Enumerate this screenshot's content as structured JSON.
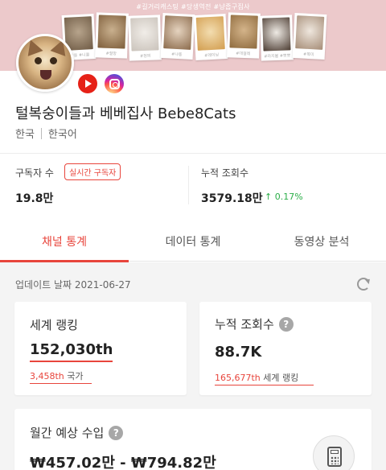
{
  "banner": {
    "tags": "#길거리캐스팅   #당생역전   #냥줍구집사",
    "photos": [
      {
        "caption": "야옹 #니콜",
        "color_a": "#b7a48c",
        "color_b": "#6e5a44"
      },
      {
        "caption": "#절망",
        "color_a": "#c9b08e",
        "color_b": "#7d5d3a"
      },
      {
        "caption": "#정의",
        "color_a": "#f1ede8",
        "color_b": "#c9c2ba"
      },
      {
        "caption": "#냐동",
        "color_a": "#e5d3bf",
        "color_b": "#8b6a4b"
      },
      {
        "caption": "#레이닝",
        "color_a": "#f3ddb0",
        "color_b": "#d29d4e"
      },
      {
        "caption": "#대걸레",
        "color_a": "#d4b48a",
        "color_b": "#8e6a3d"
      },
      {
        "caption": "#라지볼 #뽀뽀",
        "color_a": "#eeeae4",
        "color_b": "#4a3a30"
      },
      {
        "caption": "#복미",
        "color_a": "#efe7de",
        "color_b": "#a58c76"
      }
    ]
  },
  "profile": {
    "avatar_icon": "cat-avatar",
    "youtube_icon": "youtube-icon",
    "instagram_icon": "instagram-icon",
    "channel_name": "털복숭이들과 베베집사 Bebe8Cats",
    "country": "한국",
    "language": "한국어"
  },
  "stats": {
    "subscribers_label": "구독자 수",
    "realtime_badge": "실시간 구독자",
    "subscribers_value": "19.8만",
    "views_label": "누적 조회수",
    "views_value": "3579.18만",
    "views_delta": "↑ 0.17%"
  },
  "tabs": [
    {
      "label": "채널 통계",
      "active": true
    },
    {
      "label": "데이터 통계",
      "active": false
    },
    {
      "label": "동영상 분석",
      "active": false
    }
  ],
  "content": {
    "updated_text": "업데이트 날짜 2021-06-27",
    "world_rank": {
      "title": "세계 랭킹",
      "value": "152,030th",
      "sub_value": "3,458th",
      "sub_label": "국가"
    },
    "total_views": {
      "title": "누적 조회수",
      "value": "88.7K",
      "sub_value": "165,677th",
      "sub_label": "세계 랭킹"
    },
    "monthly_income": {
      "title": "월간 예상 수입",
      "value": "₩457.02만 - ₩794.82만"
    }
  },
  "colors": {
    "accent": "#e8453c",
    "positive": "#2bae48",
    "banner": "#ecc9cb"
  }
}
